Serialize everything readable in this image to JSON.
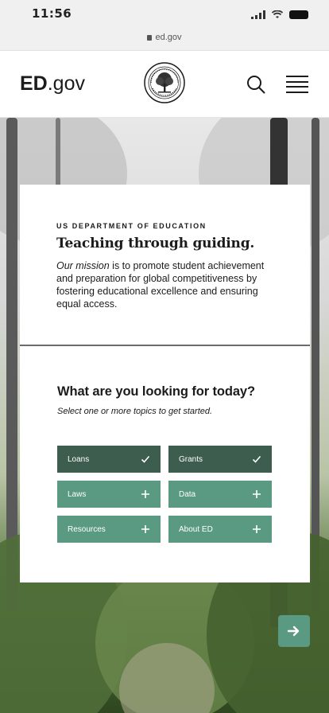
{
  "status_bar": {
    "time": "11:56",
    "url": "ed.gov"
  },
  "header": {
    "logo_strong": "ED",
    "logo_rest": ".gov",
    "seal_icon": "department-of-education-seal",
    "search_icon": "search-icon",
    "menu_icon": "hamburger-menu-icon"
  },
  "card": {
    "eyebrow": "US DEPARTMENT OF EDUCATION",
    "headline": "Teaching through guiding.",
    "mission_emphasis": "Our mission",
    "mission_rest": " is to promote student achievement and preparation for global competitiveness by fostering educational excellence and ensuring equal access."
  },
  "topics_section": {
    "title": "What are you looking for today?",
    "subtitle": "Select one or more topics to get started.",
    "topics": [
      {
        "label": "Loans",
        "selected": true,
        "icon": "checkmark-icon"
      },
      {
        "label": "Grants",
        "selected": true,
        "icon": "checkmark-icon"
      },
      {
        "label": "Laws",
        "selected": false,
        "icon": "plus-icon"
      },
      {
        "label": "Data",
        "selected": false,
        "icon": "plus-icon"
      },
      {
        "label": "Resources",
        "selected": false,
        "icon": "plus-icon"
      },
      {
        "label": "About ED",
        "selected": false,
        "icon": "plus-icon"
      }
    ]
  },
  "next_button": {
    "icon": "arrow-right-icon"
  },
  "colors": {
    "accent": "#5a9a82",
    "accent_selected": "#3d5d4f",
    "text": "#1b1b1b"
  }
}
